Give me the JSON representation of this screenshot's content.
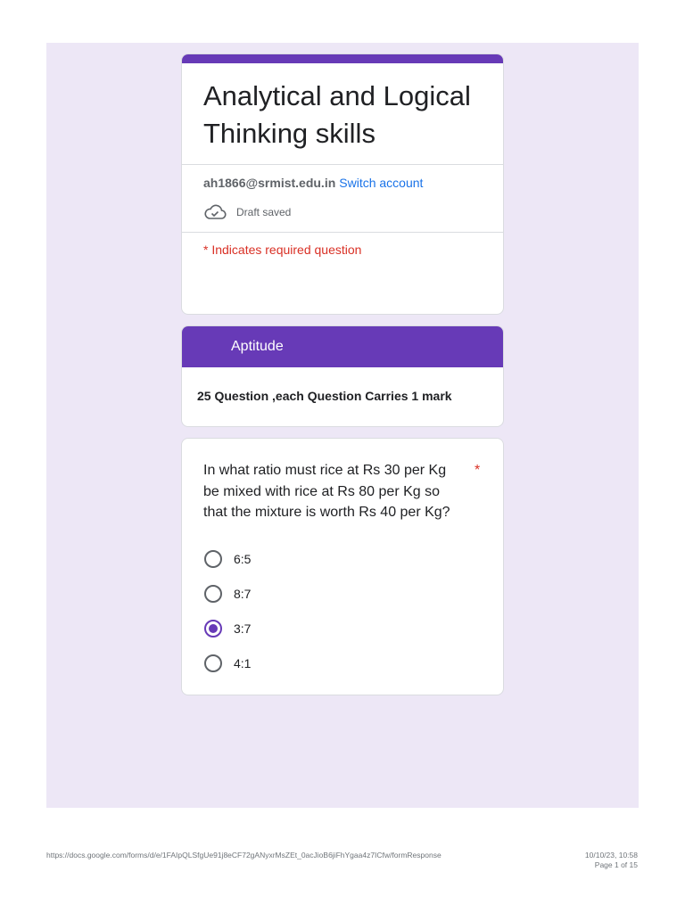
{
  "form": {
    "title": "Analytical and Logical Thinking skills",
    "account_email": "ah1866@srmist.edu.in",
    "switch_account": "Switch account",
    "draft_status": "Draft saved",
    "required_note": "* Indicates required question",
    "accent_color": "#673ab7"
  },
  "section": {
    "title": "Aptitude",
    "description": "25 Question ,each Question Carries 1 mark"
  },
  "question": {
    "text": "In what ratio must rice at Rs 30 per Kg be mixed with rice at Rs 80 per Kg so that the mixture is worth Rs 40 per Kg?",
    "required_marker": "*",
    "options": [
      "6:5",
      "8:7",
      "3:7",
      "4:1"
    ],
    "selected": "3:7"
  },
  "footer": {
    "url": "https://docs.google.com/forms/d/e/1FAIpQLSfgUe91j8eCF72gANyxrMsZEt_0acJioB6jiFhYgaa4z7ICfw/formResponse",
    "datetime": "10/10/23, 10:58",
    "page": "Page 1 of 15"
  }
}
